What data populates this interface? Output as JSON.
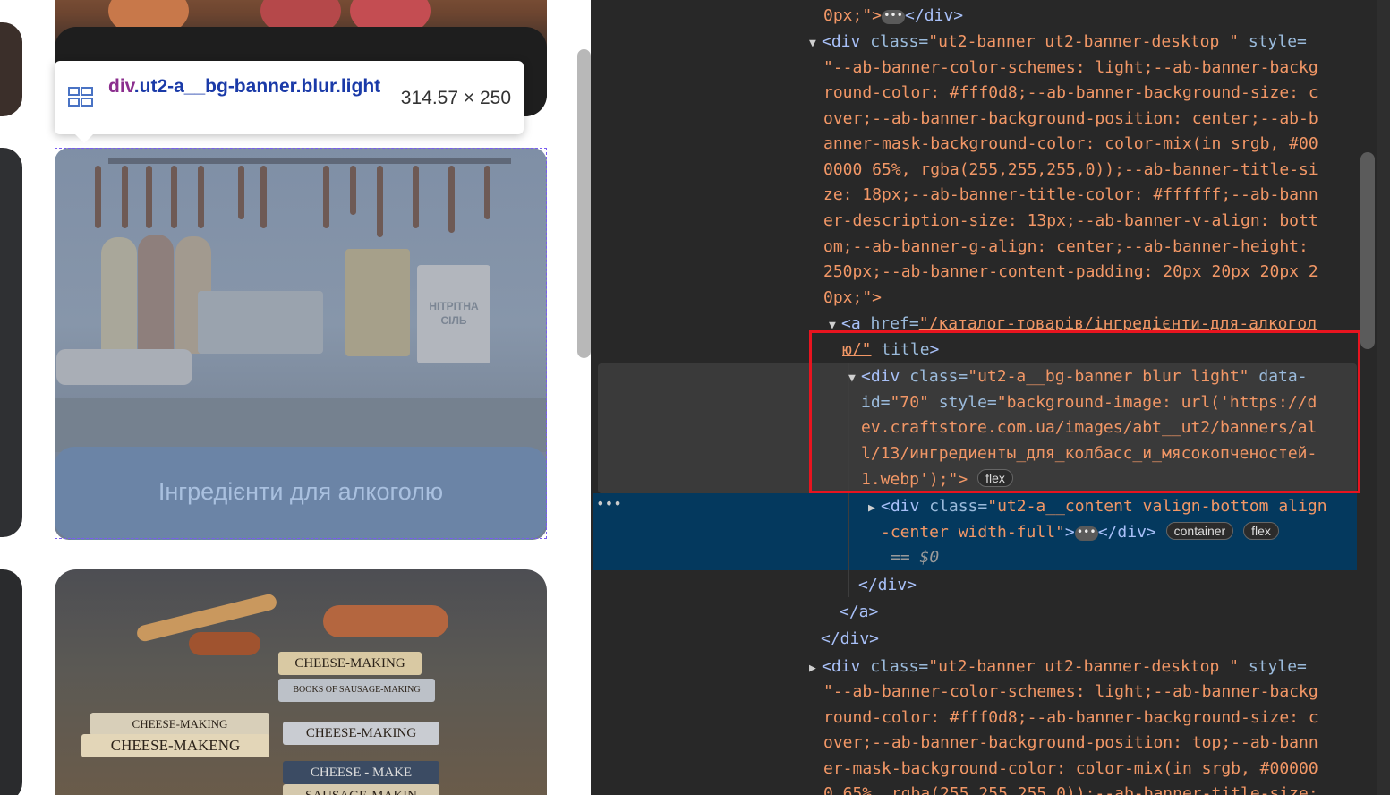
{
  "tooltip": {
    "tag": "div",
    "selector_rest": ".ut2-a__bg-banner.blur.light",
    "size": "314.57 × 250"
  },
  "banner": {
    "caption": "Інгредієнти для алкоголю",
    "pouch_label": "НІТРІТНА СІЛЬ"
  },
  "books": [
    "CHEESE-MAKING",
    "BOOKS OF SAUSAGE-MAKING",
    "CHEESE-MAKING",
    "CHEESE-MAKENG",
    "CHEESE-MAKING",
    "CHEESE - MAKE",
    "SAUSAGE-MAKIN"
  ],
  "devtools": {
    "l0": "0px;\">",
    "l0_close": "</div>",
    "banner1_open": "<div",
    "banner1_attr": "class",
    "banner1_class": "\"ut2-banner ut2-banner-desktop \"",
    "banner1_style_attr": "style=",
    "style_lines": [
      "\"--ab-banner-color-schemes: light;--ab-banner-backg",
      "round-color: #fff0d8;--ab-banner-background-size: c",
      "over;--ab-banner-background-position: center;--ab-b",
      "anner-mask-background-color: color-mix(in srgb, #00",
      "0000 65%, rgba(255,255,255,0));--ab-banner-title-si",
      "ze: 18px;--ab-banner-title-color: #ffffff;--ab-bann",
      "er-description-size: 13px;--ab-banner-v-align: bott",
      "om;--ab-banner-g-align: center;--ab-banner-height: ",
      "250px;--ab-banner-content-padding: 20px 20px 20px 2",
      "0px;\">"
    ],
    "a_open": "<a",
    "a_href_attr": "href=",
    "a_href_val": "\"/каталог-товарів/інгредієнти-для-алкогол",
    "a_href_val2": "ю/\"",
    "a_title": "title",
    "bg_open": "<div",
    "bg_class_val": "\"ut2-a__bg-banner blur light\"",
    "bg_data_attr": "data-",
    "bg_id_attr": "id=",
    "bg_id_val": "\"70\"",
    "bg_style_val": "\"background-image: url('https://d",
    "bg_lines": [
      "ev.craftstore.com.ua/images/abt__ut2/banners/al",
      "l/13/ингредиенты_для_колбасс_и_мясокопченостей-",
      "1.webp');\">"
    ],
    "badge_flex": "flex",
    "content_open": "<div",
    "content_class_val": "\"ut2-a__content valign-bottom align",
    "content_class_val2": "-center width-full\"",
    "content_close": "</div>",
    "badge_container": "container",
    "dollar0": "== $0",
    "close_div": "</div>",
    "close_a": "</a>",
    "style2_lines": [
      "\"--ab-banner-color-schemes: light;--ab-banner-backg",
      "round-color: #fff0d8;--ab-banner-background-size: c",
      "over;--ab-banner-background-position: top;--ab-bann",
      "er-mask-background-color: color-mix(in srgb, #00000",
      "0 65%, rgba(255,255,255,0));--ab-banner-title-size:"
    ]
  },
  "colors": {
    "highlight_red": "#e8141f",
    "selected_row": "#04395e",
    "attr_value": "#f29766"
  }
}
